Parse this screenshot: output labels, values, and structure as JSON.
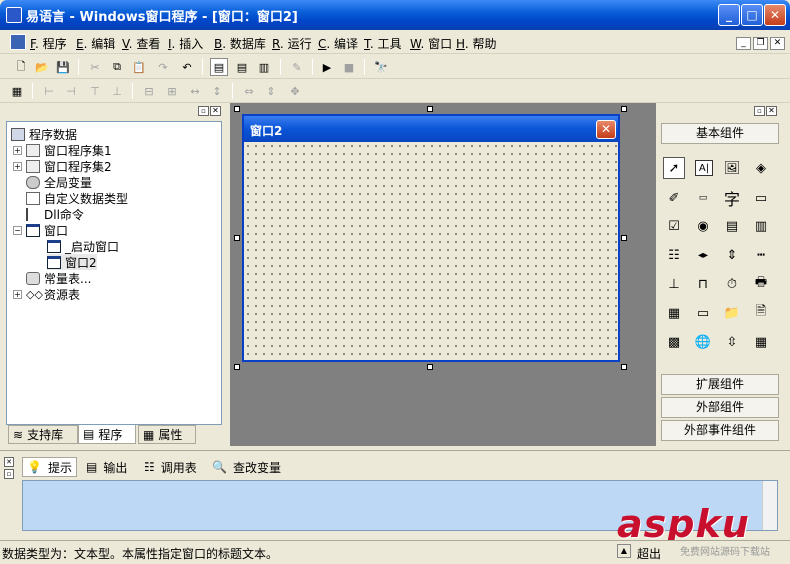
{
  "window": {
    "title": "易语言 - Windows窗口程序 - [窗口：窗口2]"
  },
  "menu": [
    {
      "key": "F",
      "label": "程序"
    },
    {
      "key": "E",
      "label": "编辑"
    },
    {
      "key": "V",
      "label": "查看"
    },
    {
      "key": "I",
      "label": "插入"
    },
    {
      "key": "B",
      "label": "数据库"
    },
    {
      "key": "R",
      "label": "运行"
    },
    {
      "key": "C",
      "label": "编译"
    },
    {
      "key": "T",
      "label": "工具"
    },
    {
      "key": "W",
      "label": "窗口"
    },
    {
      "key": "H",
      "label": "帮助"
    }
  ],
  "tree": {
    "root": "程序数据",
    "items": [
      "窗口程序集1",
      "窗口程序集2",
      "全局变量",
      "自定义数据类型",
      "Dll命令",
      "窗口",
      "_启动窗口",
      "窗口2",
      "常量表...",
      "资源表"
    ]
  },
  "left_tabs": [
    "支持库",
    "程序",
    "属性"
  ],
  "designer": {
    "window_title": "窗口2"
  },
  "components": {
    "basic_label": "基本组件",
    "extended_label": "扩展组件",
    "external_label": "外部组件",
    "external_event_label": "外部事件组件"
  },
  "output_tabs": [
    "提示",
    "输出",
    "调用表",
    "查改变量"
  ],
  "status": {
    "text": "数据类型为：文本型。本属性指定窗口的标题文本。",
    "overflow_label": "超出"
  },
  "watermark": {
    "main": "aspku",
    "sub": "免费网站源码下载站"
  }
}
